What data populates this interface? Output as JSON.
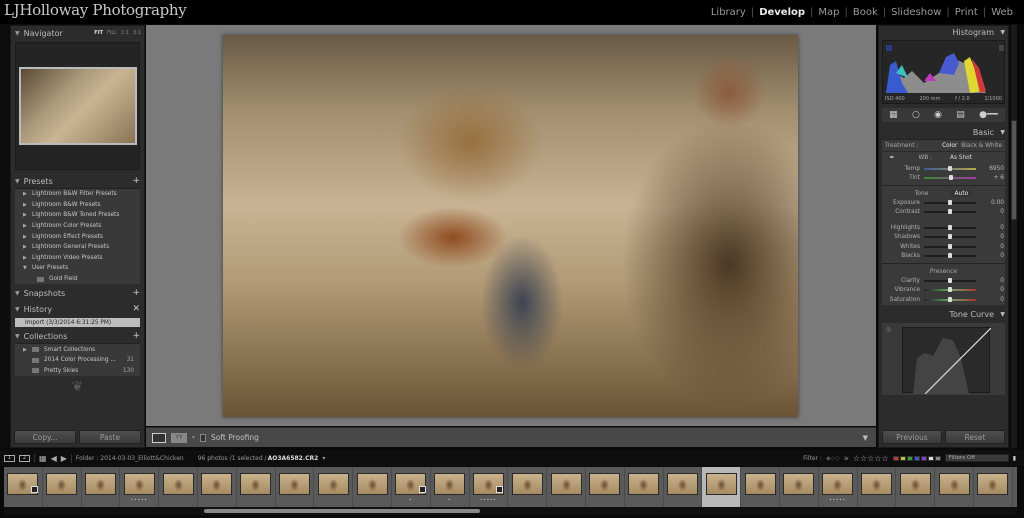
{
  "app": {
    "identity_plate": "LJHolloway Photography",
    "modules": [
      {
        "label": "Library",
        "active": false
      },
      {
        "label": "Develop",
        "active": true
      },
      {
        "label": "Map",
        "active": false
      },
      {
        "label": "Book",
        "active": false
      },
      {
        "label": "Slideshow",
        "active": false
      },
      {
        "label": "Print",
        "active": false
      },
      {
        "label": "Web",
        "active": false
      }
    ]
  },
  "left_panel": {
    "navigator": {
      "title": "Navigator",
      "zoom_options": [
        "FIT",
        "FILL",
        "1:1",
        "3:1"
      ]
    },
    "presets": {
      "title": "Presets",
      "items": [
        {
          "label": "Lightroom B&W Filter Presets"
        },
        {
          "label": "Lightroom B&W Presets"
        },
        {
          "label": "Lightroom B&W Toned Presets"
        },
        {
          "label": "Lightroom Color Presets"
        },
        {
          "label": "Lightroom Effect Presets"
        },
        {
          "label": "Lightroom General Presets"
        },
        {
          "label": "Lightroom Video Presets"
        },
        {
          "label": "User Presets"
        }
      ],
      "user_child": "Gold Field"
    },
    "snapshots": {
      "title": "Snapshots"
    },
    "history": {
      "title": "History",
      "items": [
        "Import (3/3/2014 6:31:25 PM)"
      ]
    },
    "collections": {
      "title": "Collections",
      "items": [
        {
          "label": "Smart Collections",
          "count": ""
        },
        {
          "label": "2014 Color Processing ...",
          "count": "31"
        },
        {
          "label": "Pretty Skies",
          "count": "130"
        }
      ]
    },
    "copy_label": "Copy...",
    "paste_label": "Paste"
  },
  "toolbar": {
    "soft_proofing": "Soft Proofing"
  },
  "right_panel": {
    "histogram": {
      "title": "Histogram",
      "iso": "ISO 400",
      "focal": "200 mm",
      "aperture": "f / 2.0",
      "shutter": "1/1000"
    },
    "basic": {
      "title": "Basic",
      "treatment_label": "Treatment :",
      "treatment_color": "Color",
      "treatment_bw": "Black & White",
      "wb_label": "WB :",
      "wb_value": "As Shot",
      "temp": {
        "label": "Temp",
        "value": "6950",
        "position": 0.5
      },
      "tint": {
        "label": "Tint",
        "value": "+ 6",
        "position": 0.52
      },
      "tone_label": "Tone",
      "auto_label": "Auto",
      "tone_sliders": [
        {
          "label": "Exposure",
          "value": "0.00"
        },
        {
          "label": "Contrast",
          "value": "0"
        },
        {
          "label": "Highlights",
          "value": "0"
        },
        {
          "label": "Shadows",
          "value": "0"
        },
        {
          "label": "Whites",
          "value": "0"
        },
        {
          "label": "Blacks",
          "value": "0"
        }
      ],
      "presence_label": "Presence",
      "presence_sliders": [
        {
          "label": "Clarity",
          "value": "0"
        },
        {
          "label": "Vibrance",
          "value": "0"
        },
        {
          "label": "Saturation",
          "value": "0"
        }
      ]
    },
    "tone_curve": {
      "title": "Tone Curve"
    },
    "previous_label": "Previous",
    "reset_label": "Reset"
  },
  "filmstrip": {
    "screen1": "1",
    "screen2": "2",
    "source": "Folder : 2014-03-03_Elliott&Chicken",
    "count": "96 photos /1 selected /",
    "filename": "AO3A6582.CR2",
    "filter_label": "Filter :",
    "filter_value": "Filters Off",
    "label_colors": [
      "#c23a3a",
      "#c8c23a",
      "#3aa03a",
      "#3a5ac8",
      "#8a3ac8",
      "#dddddd",
      "#888888"
    ],
    "thumbs": [
      {
        "rating": "",
        "edited": true,
        "selected": false
      },
      {
        "rating": "",
        "edited": false,
        "selected": false
      },
      {
        "rating": "",
        "edited": false,
        "selected": false
      },
      {
        "rating": "•••••",
        "edited": false,
        "selected": false
      },
      {
        "rating": "",
        "edited": false,
        "selected": false
      },
      {
        "rating": "",
        "edited": false,
        "selected": false
      },
      {
        "rating": "",
        "edited": false,
        "selected": false
      },
      {
        "rating": "",
        "edited": false,
        "selected": false
      },
      {
        "rating": "",
        "edited": false,
        "selected": false
      },
      {
        "rating": "",
        "edited": false,
        "selected": false
      },
      {
        "rating": "•",
        "edited": true,
        "selected": false
      },
      {
        "rating": "•",
        "edited": false,
        "selected": false
      },
      {
        "rating": "•••••",
        "edited": true,
        "selected": false
      },
      {
        "rating": "",
        "edited": false,
        "selected": false
      },
      {
        "rating": "",
        "edited": false,
        "selected": false
      },
      {
        "rating": "",
        "edited": false,
        "selected": false
      },
      {
        "rating": "",
        "edited": false,
        "selected": false
      },
      {
        "rating": "",
        "edited": false,
        "selected": false
      },
      {
        "rating": "",
        "edited": false,
        "selected": true
      },
      {
        "rating": "",
        "edited": false,
        "selected": false
      },
      {
        "rating": "",
        "edited": false,
        "selected": false
      },
      {
        "rating": "•••••",
        "edited": false,
        "selected": false
      },
      {
        "rating": "",
        "edited": false,
        "selected": false
      },
      {
        "rating": "",
        "edited": false,
        "selected": false
      },
      {
        "rating": "",
        "edited": false,
        "selected": false
      },
      {
        "rating": "",
        "edited": false,
        "selected": false
      }
    ]
  }
}
